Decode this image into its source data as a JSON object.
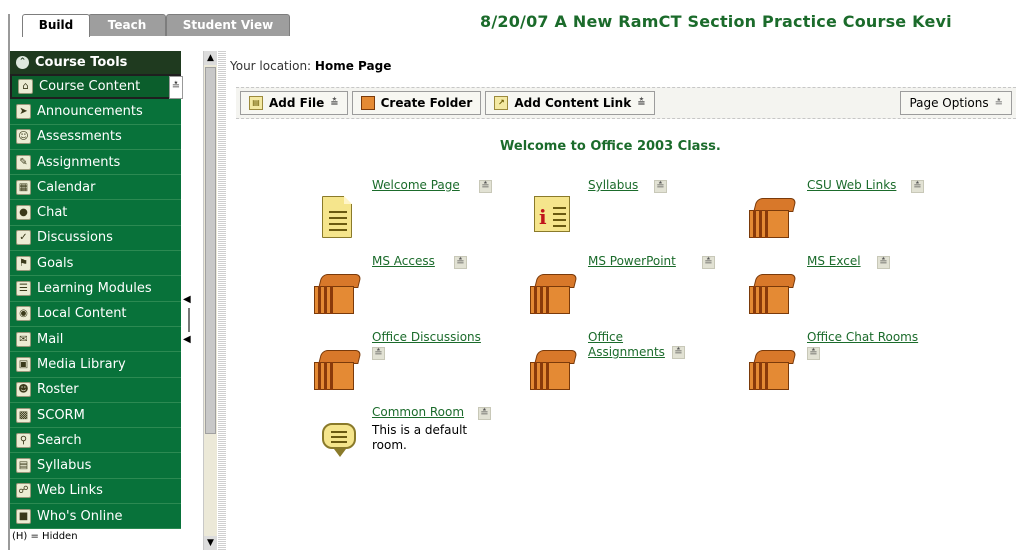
{
  "tabs": [
    {
      "label": "Build",
      "active": true
    },
    {
      "label": "Teach",
      "active": false
    },
    {
      "label": "Student View",
      "active": false
    }
  ],
  "course_title": "8/20/07 A New RamCT Section Practice Course Kevi",
  "nav": {
    "header": "Course Tools",
    "items": [
      {
        "label": "Course Content",
        "icon": "home-icon",
        "selected": true
      },
      {
        "label": "Announcements",
        "icon": "megaphone-icon"
      },
      {
        "label": "Assessments",
        "icon": "assessment-icon"
      },
      {
        "label": "Assignments",
        "icon": "assignment-icon"
      },
      {
        "label": "Calendar",
        "icon": "calendar-icon"
      },
      {
        "label": "Chat",
        "icon": "chat-icon"
      },
      {
        "label": "Discussions",
        "icon": "discussion-icon"
      },
      {
        "label": "Goals",
        "icon": "goals-icon"
      },
      {
        "label": "Learning Modules",
        "icon": "modules-icon"
      },
      {
        "label": "Local Content",
        "icon": "local-content-icon"
      },
      {
        "label": "Mail",
        "icon": "mail-icon"
      },
      {
        "label": "Media Library",
        "icon": "media-library-icon"
      },
      {
        "label": "Roster",
        "icon": "roster-icon"
      },
      {
        "label": "SCORM",
        "icon": "scorm-icon"
      },
      {
        "label": "Search",
        "icon": "search-icon"
      },
      {
        "label": "Syllabus",
        "icon": "syllabus-icon"
      },
      {
        "label": "Web Links",
        "icon": "web-links-icon"
      },
      {
        "label": "Who's Online",
        "icon": "whos-online-icon"
      }
    ],
    "footer": "(H) = Hidden"
  },
  "location": {
    "prefix": "Your location:",
    "value": "Home Page"
  },
  "toolbar": {
    "add_file": "Add File",
    "create_folder": "Create Folder",
    "add_content_link": "Add Content Link",
    "page_options": "Page Options"
  },
  "welcome": "Welcome to Office 2003 Class.",
  "items": [
    {
      "label": "Welcome Page",
      "type": "document"
    },
    {
      "label": "Syllabus",
      "type": "syllabus"
    },
    {
      "label": "CSU Web Links",
      "type": "folder"
    },
    {
      "label": "MS Access",
      "type": "folder"
    },
    {
      "label": "MS PowerPoint",
      "type": "folder"
    },
    {
      "label": "MS Excel",
      "type": "folder"
    },
    {
      "label": "Office Discussions",
      "type": "folder"
    },
    {
      "label": "Office Assignments",
      "type": "folder"
    },
    {
      "label": "Office Chat Rooms",
      "type": "folder"
    },
    {
      "label": "Common Room",
      "type": "chat",
      "description": "This is a default room."
    }
  ],
  "colors": {
    "nav_green": "#08723a",
    "title_green": "#1b6b2b",
    "header_dark": "#1f3a1f"
  }
}
